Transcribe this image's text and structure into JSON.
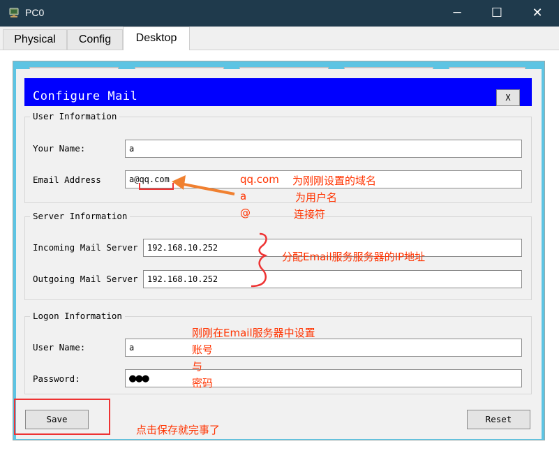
{
  "window": {
    "title": "PC0",
    "minimize_glyph": "─",
    "maximize_glyph": "☐",
    "close_glyph": "✕"
  },
  "tabs": [
    {
      "label": "Physical"
    },
    {
      "label": "Config"
    },
    {
      "label": "Desktop"
    }
  ],
  "dialog": {
    "title": "Configure Mail",
    "close_label": "X",
    "user_info": {
      "legend": "User Information",
      "name_label": "Your Name:",
      "name_value": "a",
      "email_label": "Email Address",
      "email_value": "a@qq.com"
    },
    "server_info": {
      "legend": "Server Information",
      "incoming_label": "Incoming Mail Server",
      "incoming_value": "192.168.10.252",
      "outgoing_label": "Outgoing Mail Server",
      "outgoing_value": "192.168.10.252"
    },
    "logon_info": {
      "legend": "Logon Information",
      "user_label": "User Name:",
      "user_value": "a",
      "password_label": "Password:",
      "password_mask": "●●●"
    },
    "save_label": "Save",
    "reset_label": "Reset"
  },
  "annotations": {
    "qq_com": "qq.com",
    "domain_note": "为刚刚设置的域名",
    "a_note": "a",
    "username_note": "为用户名",
    "at_note": "@",
    "connector_note": "连接符",
    "server_note": "分配Email服务服务器的IP地址",
    "logon_line1": "刚刚在Email服务器中设置",
    "logon_line2": "账号",
    "logon_line3": "与",
    "logon_line4": "密码",
    "save_note": "点击保存就完事了"
  },
  "colors": {
    "titlebar": "#1f3a4c",
    "frame": "#5dc4e3",
    "dialog_header": "#0000ff",
    "annotation": "#ff3300",
    "arrow": "#f08030"
  }
}
